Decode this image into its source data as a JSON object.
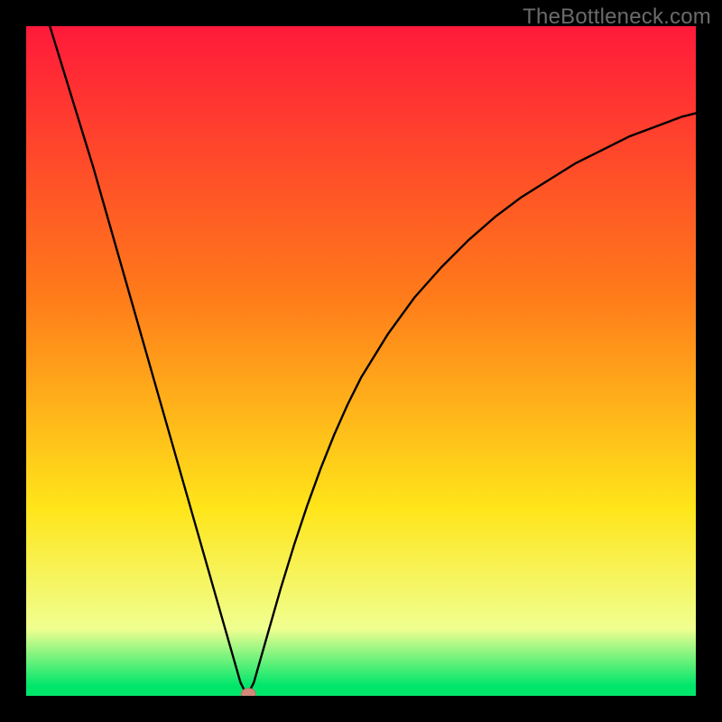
{
  "watermark": "TheBottleneck.com",
  "colors": {
    "frame": "#000000",
    "gradient_top": "#ff1a3a",
    "gradient_mid1": "#ff7a1a",
    "gradient_mid2": "#ffe51a",
    "gradient_pale": "#f0ff90",
    "gradient_green": "#00e66b",
    "curve": "#000000",
    "marker_fill": "#d18a7a",
    "marker_stroke": "#b86f60"
  },
  "chart_data": {
    "type": "line",
    "title": "",
    "xlabel": "",
    "ylabel": "",
    "xlim": [
      0,
      100
    ],
    "ylim": [
      0,
      100
    ],
    "grid": false,
    "legend": false,
    "series": [
      {
        "name": "bottleneck-curve",
        "x": [
          0,
          2,
          4,
          6,
          8,
          10,
          12,
          14,
          16,
          18,
          20,
          22,
          24,
          26,
          28,
          30,
          31,
          32,
          33,
          34,
          35,
          36,
          38,
          40,
          42,
          44,
          46,
          48,
          50,
          54,
          58,
          62,
          66,
          70,
          74,
          78,
          82,
          86,
          90,
          94,
          98,
          100
        ],
        "y": [
          112,
          105,
          98.5,
          92,
          85.5,
          79,
          72,
          65,
          58,
          51,
          44,
          37,
          30,
          23,
          16,
          9,
          5.5,
          2,
          0,
          2,
          5.5,
          9,
          16,
          22.5,
          28.5,
          34,
          39,
          43.5,
          47.5,
          54,
          59.5,
          64,
          68,
          71.5,
          74.5,
          77,
          79.5,
          81.5,
          83.5,
          85,
          86.5,
          87
        ]
      }
    ],
    "marker": {
      "x": 33.2,
      "y": 0.3
    },
    "gradient_stops": [
      {
        "pos": 0.0,
        "color": "#ff1a3a"
      },
      {
        "pos": 0.4,
        "color": "#ff7a1a"
      },
      {
        "pos": 0.72,
        "color": "#ffe51a"
      },
      {
        "pos": 0.9,
        "color": "#f0ff90"
      },
      {
        "pos": 0.985,
        "color": "#00e66b"
      },
      {
        "pos": 1.0,
        "color": "#00e66b"
      }
    ]
  }
}
